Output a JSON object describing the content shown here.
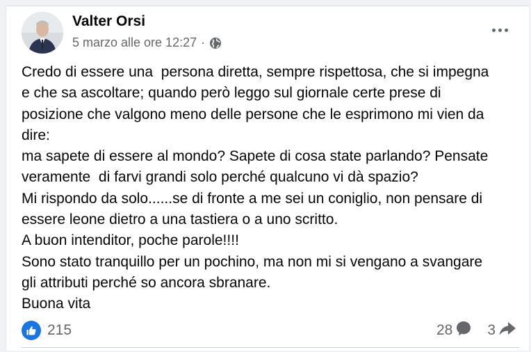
{
  "post": {
    "author": "Valter Orsi",
    "timestamp": "5 marzo alle ore 12:27",
    "separator": "·",
    "privacy_icon": "globe-icon",
    "more_icon": "more-options-icon",
    "body_lines": [
      "Credo di essere una  persona diretta, sempre rispettosa, che si impegna",
      "e che sa ascoltare; quando però leggo sul giornale certe prese di",
      "posizione che valgono meno delle persone che le esprimono mi vien da",
      "dire:",
      "ma sapete di essere al mondo? Sapete di cosa state parlando? Pensate",
      "veramente  di farvi grandi solo perché qualcuno vi dà spazio?",
      "Mi rispondo da solo......se di fronte a me sei un coniglio, non pensare di",
      "essere leone dietro a una tastiera o a uno scritto.",
      "A buon intenditor, poche parole!!!!",
      "Sono stato tranquillo per un pochino, ma non mi si vengano a svangare",
      "gli attributi perché so ancora sbranare.",
      "Buona vita"
    ]
  },
  "reactions": {
    "icon": "like-icon",
    "count": "215"
  },
  "comments": {
    "count": "28",
    "icon": "comment-icon"
  },
  "shares": {
    "count": "3",
    "icon": "share-icon"
  },
  "colors": {
    "like_blue": "#1b74e4",
    "secondary_text": "#65676b",
    "primary_text": "#050505"
  }
}
